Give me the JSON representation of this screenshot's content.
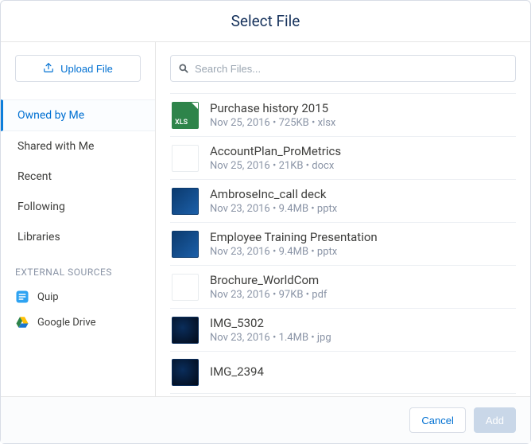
{
  "header": {
    "title": "Select File"
  },
  "upload": {
    "label": "Upload File"
  },
  "nav": {
    "items": [
      {
        "label": "Owned by Me",
        "selected": true
      },
      {
        "label": "Shared with Me",
        "selected": false
      },
      {
        "label": "Recent",
        "selected": false
      },
      {
        "label": "Following",
        "selected": false
      },
      {
        "label": "Libraries",
        "selected": false
      }
    ]
  },
  "external": {
    "header": "EXTERNAL SOURCES",
    "items": [
      {
        "label": "Quip",
        "icon": "quip"
      },
      {
        "label": "Google Drive",
        "icon": "gdrive"
      }
    ]
  },
  "search": {
    "placeholder": "Search Files..."
  },
  "files": [
    {
      "name": "Purchase history 2015",
      "date": "Nov 25, 2016",
      "size": "725KB",
      "ext": "xlsx",
      "thumb": "xls"
    },
    {
      "name": "AccountPlan_ProMetrics",
      "date": "Nov 25, 2016",
      "size": "21KB",
      "ext": "docx",
      "thumb": "docx"
    },
    {
      "name": "AmbroseInc_call deck",
      "date": "Nov 23, 2016",
      "size": "9.4MB",
      "ext": "pptx",
      "thumb": "ppt"
    },
    {
      "name": "Employee Training Presentation",
      "date": "Nov 23, 2016",
      "size": "9.4MB",
      "ext": "pptx",
      "thumb": "ppt"
    },
    {
      "name": "Brochure_WorldCom",
      "date": "Nov 23, 2016",
      "size": "97KB",
      "ext": "pdf",
      "thumb": "pdf"
    },
    {
      "name": "IMG_5302",
      "date": "Nov 23, 2016",
      "size": "1.4MB",
      "ext": "jpg",
      "thumb": "jpg"
    },
    {
      "name": "IMG_2394",
      "date": "",
      "size": "",
      "ext": "",
      "thumb": "jpg"
    }
  ],
  "footer": {
    "cancel": "Cancel",
    "add": "Add"
  },
  "meta_sep": " • "
}
